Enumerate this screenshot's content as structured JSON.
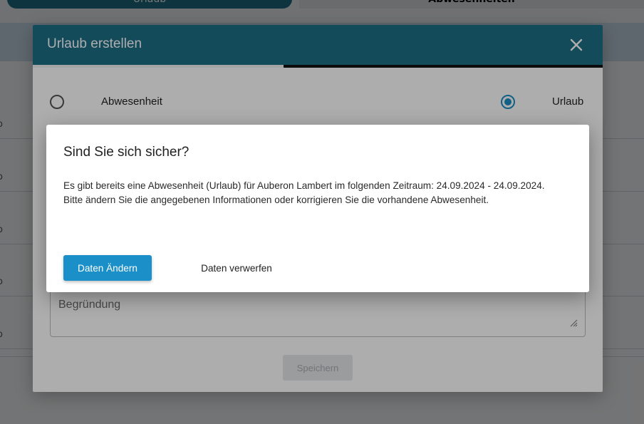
{
  "background": {
    "tabs": [
      {
        "label": "Urlaub",
        "active": true
      },
      {
        "label": "Abwesenheiten",
        "active": false
      }
    ],
    "row_marks": [
      "o",
      "o",
      "o",
      "o",
      "o"
    ]
  },
  "main_modal": {
    "title": "Urlaub erstellen",
    "close_icon": "close-icon",
    "step_progress": 0.44,
    "radio_options": [
      {
        "label": "Abwesenheit",
        "checked": false
      },
      {
        "label": "Urlaub",
        "checked": true
      }
    ],
    "reason_placeholder": "Begründung",
    "save_label": "Speichern"
  },
  "confirm_dialog": {
    "title": "Sind Sie sich sicher?",
    "message_line1": "Es gibt bereits eine Abwesenheit (Urlaub) für Auberon Lambert im folgenden Zeitraum: 24.09.2024 - 24.09.2024.",
    "message_line2": "Bitte ändern Sie die angegebenen Informationen oder korrigieren Sie die vorhandene Abwesenheit.",
    "primary_button": "Daten Ändern",
    "secondary_button": "Daten verwerfen"
  },
  "colors": {
    "header": "#1d6f86",
    "primary": "#1a8fc8"
  }
}
